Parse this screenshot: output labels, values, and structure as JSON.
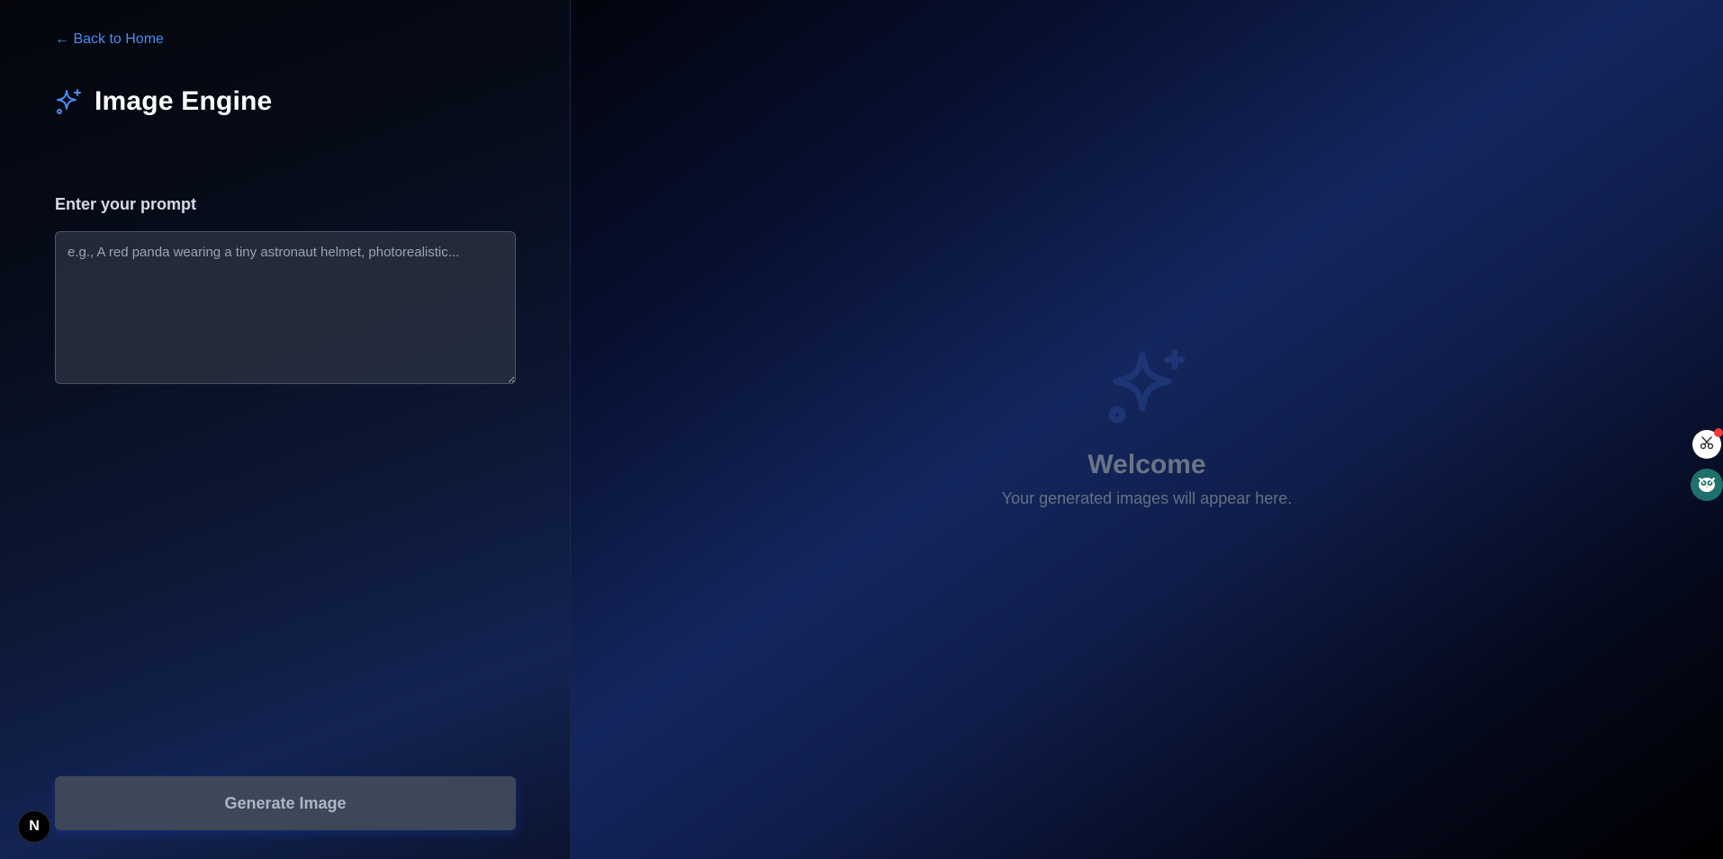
{
  "nav": {
    "back_label": "← Back to Home"
  },
  "header": {
    "title": "Image Engine",
    "icon": "sparkles-icon"
  },
  "prompt": {
    "label": "Enter your prompt",
    "placeholder": "e.g., A red panda wearing a tiny astronaut helmet, photorealistic...",
    "value": ""
  },
  "actions": {
    "generate_label": "Generate Image"
  },
  "preview": {
    "welcome_title": "Welcome",
    "welcome_subtitle": "Your generated images will appear here.",
    "icon": "sparkles-icon"
  },
  "badge": {
    "label": "N"
  },
  "colors": {
    "accent": "#4a8cf0",
    "button_bg": "#3d4759",
    "placeholder_icon": "#1e3575"
  }
}
